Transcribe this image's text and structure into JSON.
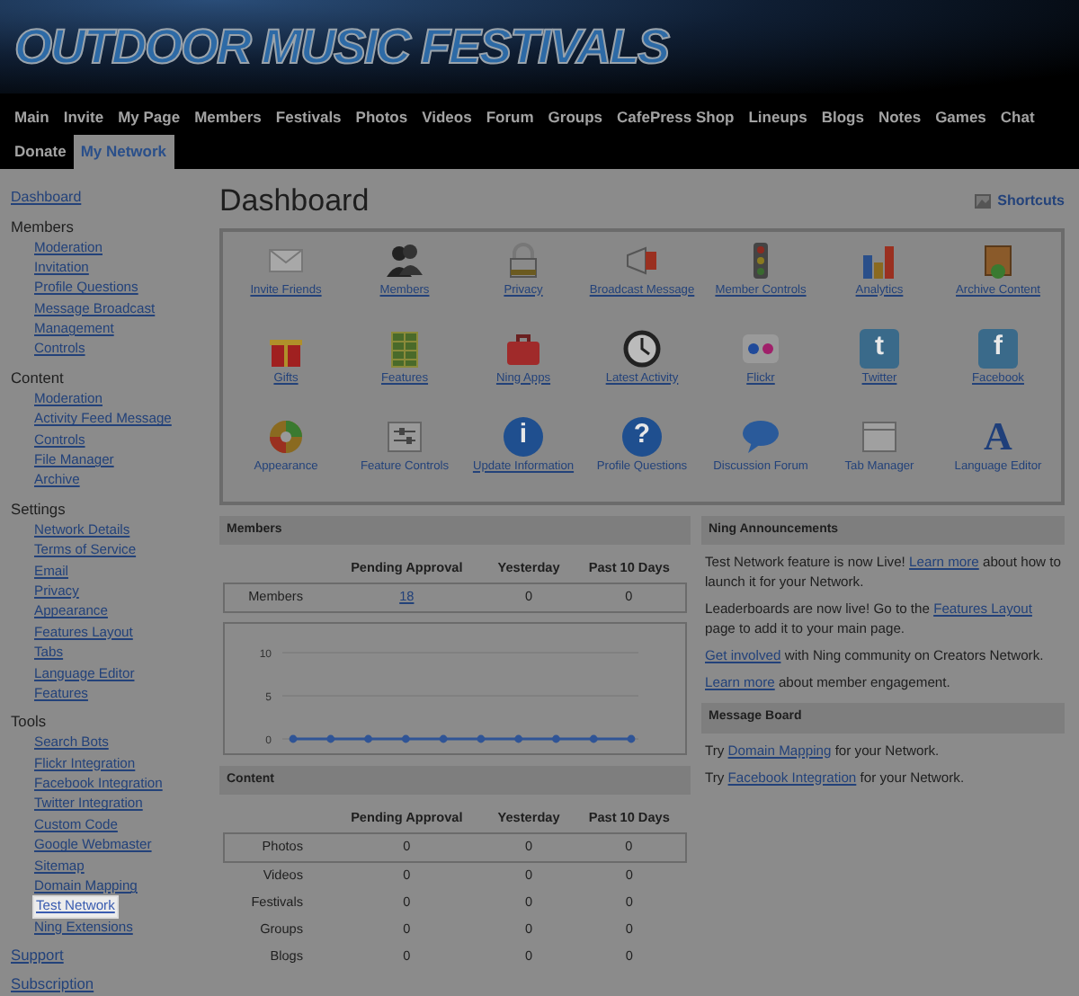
{
  "site_title": "OUTDOOR MUSIC FESTIVALS",
  "nav": [
    {
      "label": "Main",
      "selected": false
    },
    {
      "label": "Invite",
      "selected": false
    },
    {
      "label": "My Page",
      "selected": false
    },
    {
      "label": "Members",
      "selected": false
    },
    {
      "label": "Festivals",
      "selected": false
    },
    {
      "label": "Photos",
      "selected": false
    },
    {
      "label": "Videos",
      "selected": false
    },
    {
      "label": "Forum",
      "selected": false
    },
    {
      "label": "Groups",
      "selected": false
    },
    {
      "label": "CafePress Shop",
      "selected": false
    },
    {
      "label": "Lineups",
      "selected": false
    },
    {
      "label": "Blogs",
      "selected": false
    },
    {
      "label": "Notes",
      "selected": false
    },
    {
      "label": "Games",
      "selected": false
    },
    {
      "label": "Chat",
      "selected": false
    },
    {
      "label": "Donate",
      "selected": false
    },
    {
      "label": "My Network",
      "selected": true
    }
  ],
  "sidebar": {
    "items": [
      {
        "kind": "link",
        "label": "Dashboard",
        "selected": false
      },
      {
        "kind": "heading",
        "label": "Members",
        "children": [
          {
            "label": "Moderation",
            "selected": false
          },
          {
            "label": "Invitation",
            "selected": false
          },
          {
            "label": "Profile Questions",
            "selected": false
          },
          {
            "label": "Message Broadcast",
            "selected": false
          },
          {
            "label": "Management",
            "selected": false
          },
          {
            "label": "Controls",
            "selected": false
          }
        ]
      },
      {
        "kind": "heading",
        "label": "Content",
        "children": [
          {
            "label": "Moderation",
            "selected": false
          },
          {
            "label": "Activity Feed Message",
            "selected": false
          },
          {
            "label": "Controls",
            "selected": false
          },
          {
            "label": "File Manager",
            "selected": false
          },
          {
            "label": "Archive",
            "selected": false
          }
        ]
      },
      {
        "kind": "heading",
        "label": "Settings",
        "children": [
          {
            "label": "Network Details",
            "selected": false
          },
          {
            "label": "Terms of Service",
            "selected": false
          },
          {
            "label": "Email",
            "selected": false
          },
          {
            "label": "Privacy",
            "selected": false
          },
          {
            "label": "Appearance",
            "selected": false
          },
          {
            "label": "Features Layout",
            "selected": false
          },
          {
            "label": "Tabs",
            "selected": false
          },
          {
            "label": "Language Editor",
            "selected": false
          },
          {
            "label": "Features",
            "selected": false
          }
        ]
      },
      {
        "kind": "heading",
        "label": "Tools",
        "children": [
          {
            "label": "Search Bots",
            "selected": false
          },
          {
            "label": "Flickr Integration",
            "selected": false
          },
          {
            "label": "Facebook Integration",
            "selected": false
          },
          {
            "label": "Twitter Integration",
            "selected": false
          },
          {
            "label": "Custom Code",
            "selected": false
          },
          {
            "label": "Google Webmaster",
            "selected": false
          },
          {
            "label": "Sitemap",
            "selected": false
          },
          {
            "label": "Domain Mapping",
            "selected": false
          },
          {
            "label": "Test Network",
            "selected": true
          },
          {
            "label": "Ning Extensions",
            "selected": false
          }
        ]
      },
      {
        "kind": "link",
        "label": "Support",
        "selected": false
      },
      {
        "kind": "link",
        "label": "Subscription",
        "selected": false
      }
    ]
  },
  "dashboard": {
    "title": "Dashboard",
    "shortcuts": "Shortcuts",
    "tools": [
      {
        "label": "Invite Friends",
        "link": true
      },
      {
        "label": "Members",
        "link": true
      },
      {
        "label": "Privacy",
        "link": true
      },
      {
        "label": "Broadcast Message",
        "link": true
      },
      {
        "label": "Member Controls",
        "link": true
      },
      {
        "label": "Analytics",
        "link": true
      },
      {
        "label": "Archive Content",
        "link": true
      },
      {
        "label": "Gifts",
        "link": true
      },
      {
        "label": "Features",
        "link": true
      },
      {
        "label": "Ning Apps",
        "link": true
      },
      {
        "label": "Latest Activity",
        "link": true
      },
      {
        "label": "Flickr",
        "link": true
      },
      {
        "label": "Twitter",
        "link": true,
        "glyph": "t"
      },
      {
        "label": "Facebook",
        "link": true,
        "glyph": "f"
      },
      {
        "label": "Appearance",
        "link": false
      },
      {
        "label": "Feature Controls",
        "link": false
      },
      {
        "label": "Update Information",
        "link": true,
        "glyph": "i"
      },
      {
        "label": "Profile Questions",
        "link": false,
        "glyph": "?"
      },
      {
        "label": "Discussion Forum",
        "link": false
      },
      {
        "label": "Tab Manager",
        "link": false
      },
      {
        "label": "Language Editor",
        "link": false,
        "glyph": "A"
      }
    ]
  },
  "members": {
    "heading": "Members",
    "columns": [
      "Pending Approval",
      "Yesterday",
      "Past 10 Days"
    ],
    "rows": [
      {
        "label": "Members",
        "boxed": true,
        "cells": [
          {
            "text": "18",
            "link": true
          },
          {
            "text": "0",
            "link": false
          },
          {
            "text": "0",
            "link": false
          }
        ]
      }
    ],
    "chart_data": {
      "type": "line",
      "ylim": [
        0,
        10
      ],
      "yticks": [
        0,
        5,
        10
      ],
      "series": [
        {
          "color": "#2f5496",
          "marker": true,
          "values": [
            0,
            0,
            0,
            0,
            0,
            0,
            0,
            0,
            0,
            0
          ]
        }
      ]
    }
  },
  "content": {
    "heading": "Content",
    "columns": [
      "Pending Approval",
      "Yesterday",
      "Past 10 Days"
    ],
    "rows": [
      {
        "label": "Photos",
        "boxed": true,
        "cells": [
          {
            "text": "0",
            "link": false
          },
          {
            "text": "0",
            "link": false
          },
          {
            "text": "0",
            "link": false
          }
        ]
      },
      {
        "label": "Videos",
        "boxed": false,
        "cells": [
          {
            "text": "0",
            "link": false
          },
          {
            "text": "0",
            "link": false
          },
          {
            "text": "0",
            "link": false
          }
        ]
      },
      {
        "label": "Festivals",
        "boxed": false,
        "cells": [
          {
            "text": "0",
            "link": false
          },
          {
            "text": "0",
            "link": false
          },
          {
            "text": "0",
            "link": false
          }
        ]
      },
      {
        "label": "Groups",
        "boxed": false,
        "cells": [
          {
            "text": "0",
            "link": false
          },
          {
            "text": "0",
            "link": false
          },
          {
            "text": "0",
            "link": false
          }
        ]
      },
      {
        "label": "Blogs",
        "boxed": false,
        "cells": [
          {
            "text": "0",
            "link": false
          },
          {
            "text": "0",
            "link": false
          },
          {
            "text": "0",
            "link": false
          }
        ]
      }
    ]
  },
  "announcements": {
    "heading": "Ning Announcements",
    "paragraphs": [
      [
        {
          "text": "Test Network feature is now Live! "
        },
        {
          "link": "Learn more"
        },
        {
          "text": " about how to launch it for your Network."
        }
      ],
      [
        {
          "text": "Leaderboards are now live! Go to the "
        },
        {
          "link": "Features Layout"
        },
        {
          "text": " page to add it to your main page."
        }
      ],
      [
        {
          "link": "Get involved"
        },
        {
          "text": " with Ning community on Creators Network."
        }
      ],
      [
        {
          "link": "Learn more"
        },
        {
          "text": " about member engagement."
        }
      ]
    ]
  },
  "message_board": {
    "heading": "Message Board",
    "paragraphs": [
      [
        {
          "text": "Try "
        },
        {
          "link": "Domain Mapping"
        },
        {
          "text": " for your Network."
        }
      ],
      [
        {
          "text": "Try "
        },
        {
          "link": "Facebook Integration"
        },
        {
          "text": " for your Network."
        }
      ]
    ]
  }
}
